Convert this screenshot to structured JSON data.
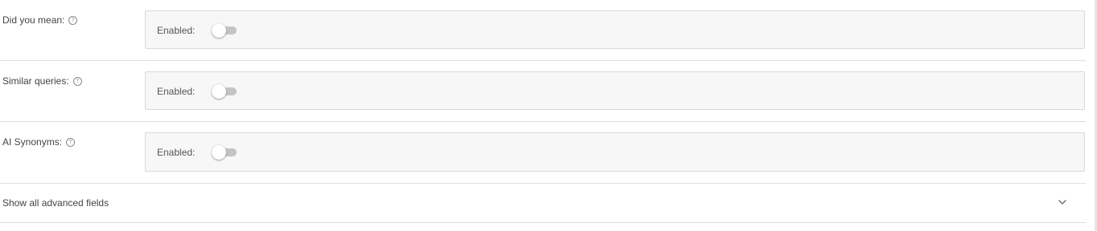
{
  "settings": {
    "rows": [
      {
        "label": "Did you mean:",
        "field_label": "Enabled:",
        "enabled": false
      },
      {
        "label": "Similar queries:",
        "field_label": "Enabled:",
        "enabled": false
      },
      {
        "label": "AI Synonyms:",
        "field_label": "Enabled:",
        "enabled": false
      }
    ],
    "help_icon_glyph": "?",
    "icons": {
      "help": "help-circle-icon",
      "chevron": "chevron-down-icon"
    }
  },
  "advanced": {
    "label": "Show all advanced fields",
    "expanded": false
  },
  "colors": {
    "field_background": "#f7f7f7",
    "toggle_off_track": "#c4c4c4",
    "divider": "#dedede"
  }
}
